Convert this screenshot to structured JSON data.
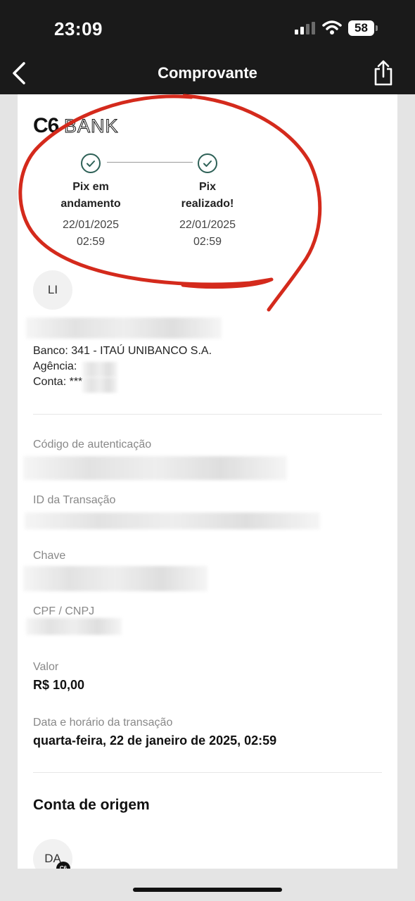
{
  "status_bar": {
    "time": "23:09",
    "battery": "58"
  },
  "header": {
    "title": "Comprovante"
  },
  "brand": {
    "c6": "C6",
    "bank": "BANK"
  },
  "steps": [
    {
      "name_line1": "Pix em",
      "name_line2": "andamento",
      "date": "22/01/2025",
      "time": "02:59"
    },
    {
      "name_line1": "Pix",
      "name_line2": "realizado!",
      "date": "22/01/2025",
      "time": "02:59"
    }
  ],
  "recipient": {
    "initials": "LI",
    "banco": "Banco: 341 - ITAÚ UNIBANCO S.A.",
    "agencia": "Agência:",
    "conta": "Conta: ***"
  },
  "details": {
    "auth_label": "Código de autenticação",
    "tx_label": "ID da Transação",
    "chave_label": "Chave",
    "cpf_label": "CPF / CNPJ",
    "valor_label": "Valor",
    "valor": "R$ 10,00",
    "data_label": "Data e horário da transação",
    "data": "quarta-feira, 22 de janeiro de 2025, 02:59"
  },
  "origin": {
    "section_title": "Conta de origem",
    "initials": "DA",
    "badge": "C6"
  },
  "colors": {
    "accent": "#2e6157",
    "annotation": "#d42a1c",
    "topbar": "#1a1a1a"
  }
}
